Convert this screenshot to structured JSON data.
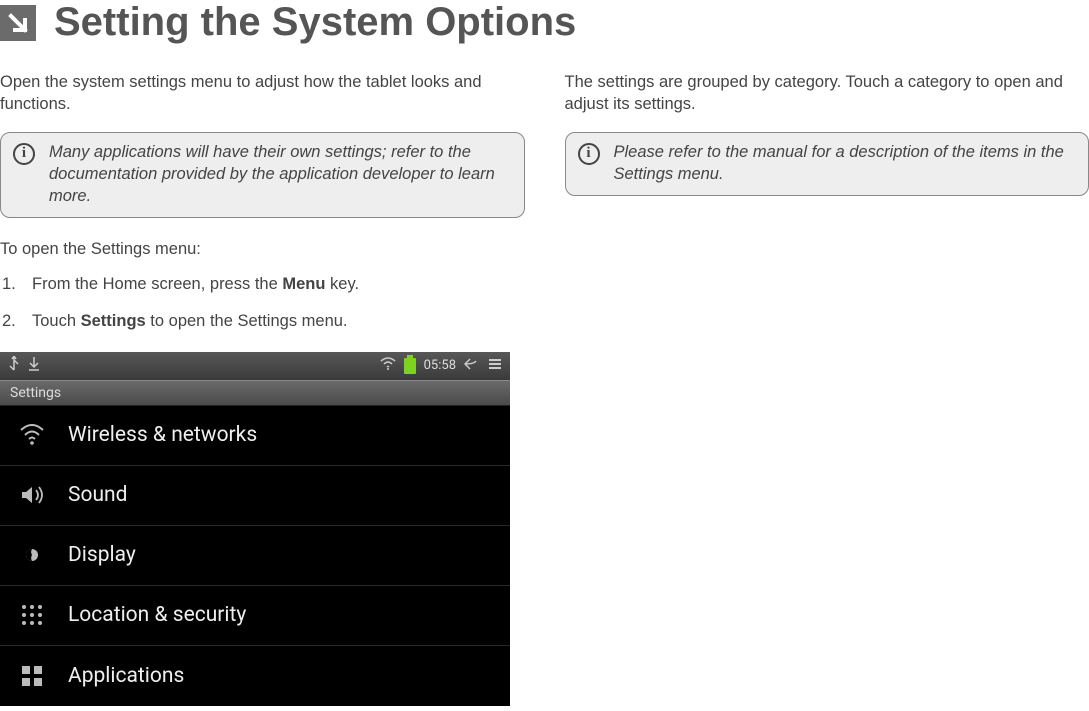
{
  "header": {
    "arrow_glyph": "↘",
    "title": "Setting the System Options"
  },
  "left_column": {
    "intro": "Open the system settings menu to adjust how the tablet looks and functions.",
    "info_box": "Many applications will have their own settings; refer to the documentation provided by the application developer to learn more.",
    "sub_heading": "To open the Settings menu:",
    "steps": [
      {
        "num": "1.",
        "pre": "From the Home screen, press the ",
        "bold": "Menu",
        "post": " key."
      },
      {
        "num": "2.",
        "pre": "Touch ",
        "bold": "Settings",
        "post": " to open the Settings menu."
      }
    ]
  },
  "right_column": {
    "intro": "The settings are grouped by category. Touch a category to open and adjust its settings.",
    "info_box": "Please refer to the manual for a description of the items in the Settings menu."
  },
  "info_icon_glyph": "i",
  "screenshot": {
    "status": {
      "time": "05:58",
      "left_icons": [
        "usb",
        "down"
      ],
      "right_icons": [
        "wifi",
        "battery",
        "back",
        "menu"
      ]
    },
    "title": "Settings",
    "rows": [
      {
        "icon": "wifi",
        "label": "Wireless & networks"
      },
      {
        "icon": "sound",
        "label": "Sound"
      },
      {
        "icon": "display",
        "label": "Display"
      },
      {
        "icon": "location",
        "label": "Location & security"
      },
      {
        "icon": "apps",
        "label": "Applications"
      }
    ]
  }
}
